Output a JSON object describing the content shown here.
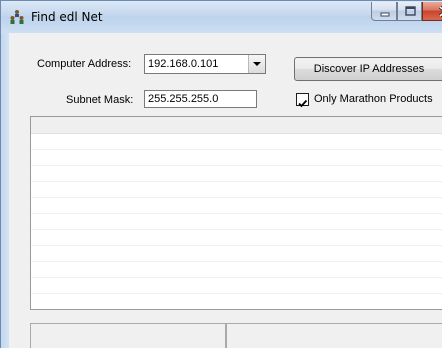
{
  "window": {
    "title": "Find edl Net",
    "icon": "network-users-icon"
  },
  "form": {
    "computer_address_label": "Computer Address:",
    "computer_address_value": "192.168.0.101",
    "subnet_mask_label": "Subnet Mask:",
    "subnet_mask_value": "255.255.255.0",
    "discover_button_label": "Discover IP Addresses",
    "only_marathon_label": "Only Marathon Products",
    "only_marathon_checked": true
  },
  "results": {
    "rows": []
  },
  "status": {
    "pane1": "",
    "pane2": ""
  },
  "colors": {
    "titlebar": "#c7d9ee",
    "close_button": "#c8442a"
  }
}
